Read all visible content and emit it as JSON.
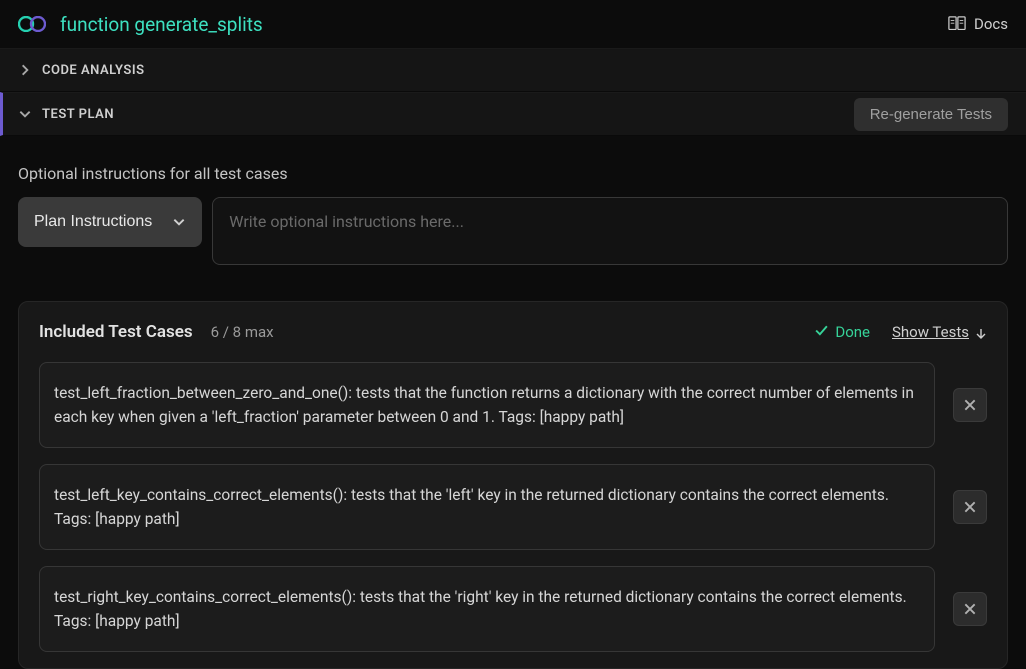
{
  "header": {
    "title": "function generate_splits",
    "docs_label": "Docs"
  },
  "sections": {
    "code_analysis": {
      "label": "CODE ANALYSIS"
    },
    "test_plan": {
      "label": "TEST PLAN",
      "regenerate_label": "Re-generate Tests"
    }
  },
  "instructions": {
    "label": "Optional instructions for all test cases",
    "dropdown_label": "Plan Instructions",
    "placeholder": "Write optional instructions here...",
    "value": ""
  },
  "panel": {
    "title": "Included Test Cases",
    "count": "6 / 8 max",
    "status": "Done",
    "show_tests": "Show Tests"
  },
  "tests": [
    {
      "text": "test_left_fraction_between_zero_and_one(): tests that the function returns a dictionary with the correct number of elements in each key when given a 'left_fraction' parameter between 0 and 1. Tags: [happy path]"
    },
    {
      "text": "test_left_key_contains_correct_elements(): tests that the 'left' key in the returned dictionary contains the correct elements. Tags: [happy path]"
    },
    {
      "text": "test_right_key_contains_correct_elements(): tests that the 'right' key in the returned dictionary contains the correct elements. Tags: [happy path]"
    }
  ]
}
